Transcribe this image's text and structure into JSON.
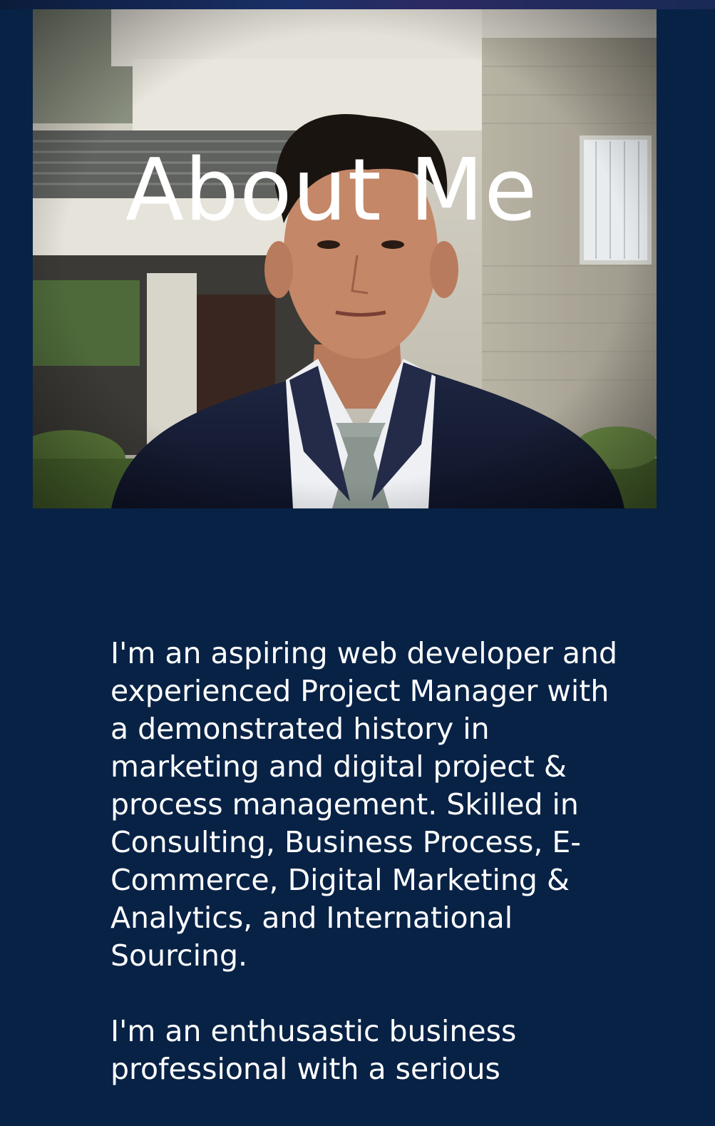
{
  "hero": {
    "title": "About Me",
    "photo_icon": "portrait-photo"
  },
  "bio": {
    "paragraphs": [
      "I'm an aspiring web developer and experienced Project Manager with a demonstrated history in marketing and digital project & process management. Skilled in Consulting, Business Process, E-Commerce, Digital Marketing & Analytics, and International Sourcing.",
      "I'm an enthusastic business professional with a serious"
    ]
  },
  "colors": {
    "background": "#082246",
    "text": "#ffffff"
  }
}
